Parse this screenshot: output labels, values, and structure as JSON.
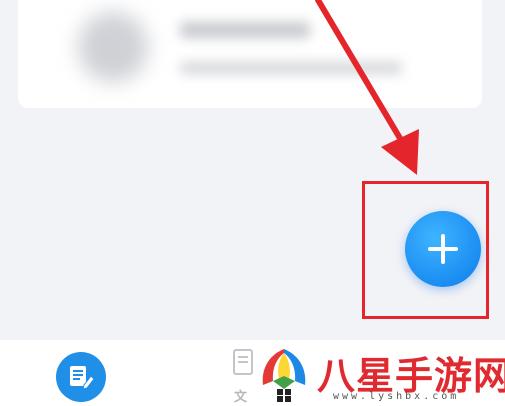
{
  "list": {
    "card": {
      "title": "",
      "subtitle": ""
    }
  },
  "fab": {
    "icon": "plus-icon",
    "color": "#1a8df2"
  },
  "annotation": {
    "color": "#e4262c"
  },
  "tabbar": {
    "tabs": [
      {
        "icon": "document-edit-icon",
        "label": ""
      },
      {
        "icon": "document-icon",
        "label": "文"
      }
    ]
  },
  "watermark": {
    "title": "八星手游网",
    "url": "www.lyshbx.com"
  }
}
